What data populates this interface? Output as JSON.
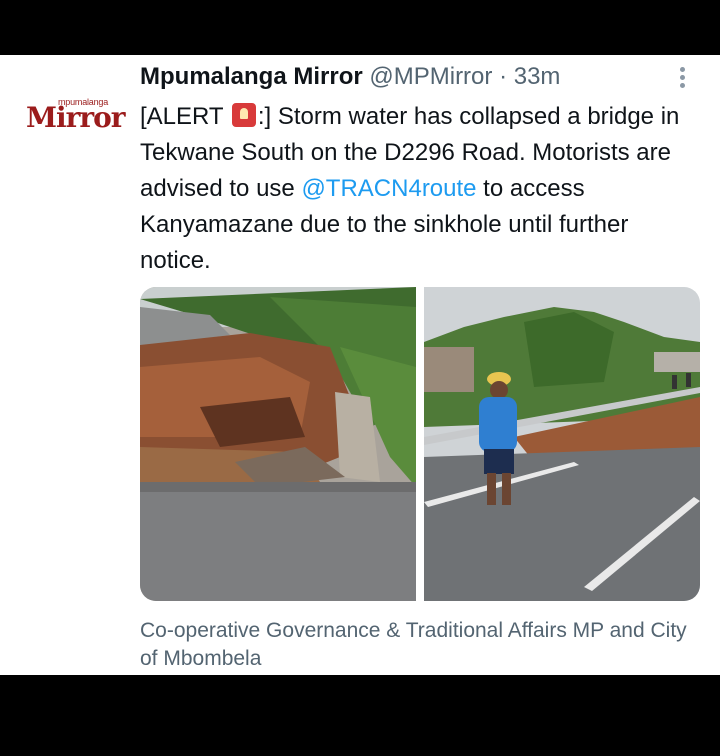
{
  "tweet": {
    "display_name": "Mpumalanga Mirror",
    "handle": "@MPMirror",
    "separator": "·",
    "time": "33m",
    "avatar": {
      "small_text": "mpumalanga",
      "big_text": "Mirror"
    },
    "text": {
      "part1": "[ALERT ",
      "emoji": "police-light-icon",
      "part2": ":] Storm water has collapsed a bridge in Tekwane South on the D2296 Road. Motorists are advised to use ",
      "mention": "@TRACN4route",
      "part3": " to access Kanyamazane due to the sinkhole until further notice."
    },
    "media_caption": "Co-operative Governance & Traditional Affairs MP and City of Mbombela"
  },
  "colors": {
    "text_primary": "#0f1419",
    "text_secondary": "#536471",
    "link": "#1d9bf0",
    "brand_red": "#9b1c1c"
  }
}
